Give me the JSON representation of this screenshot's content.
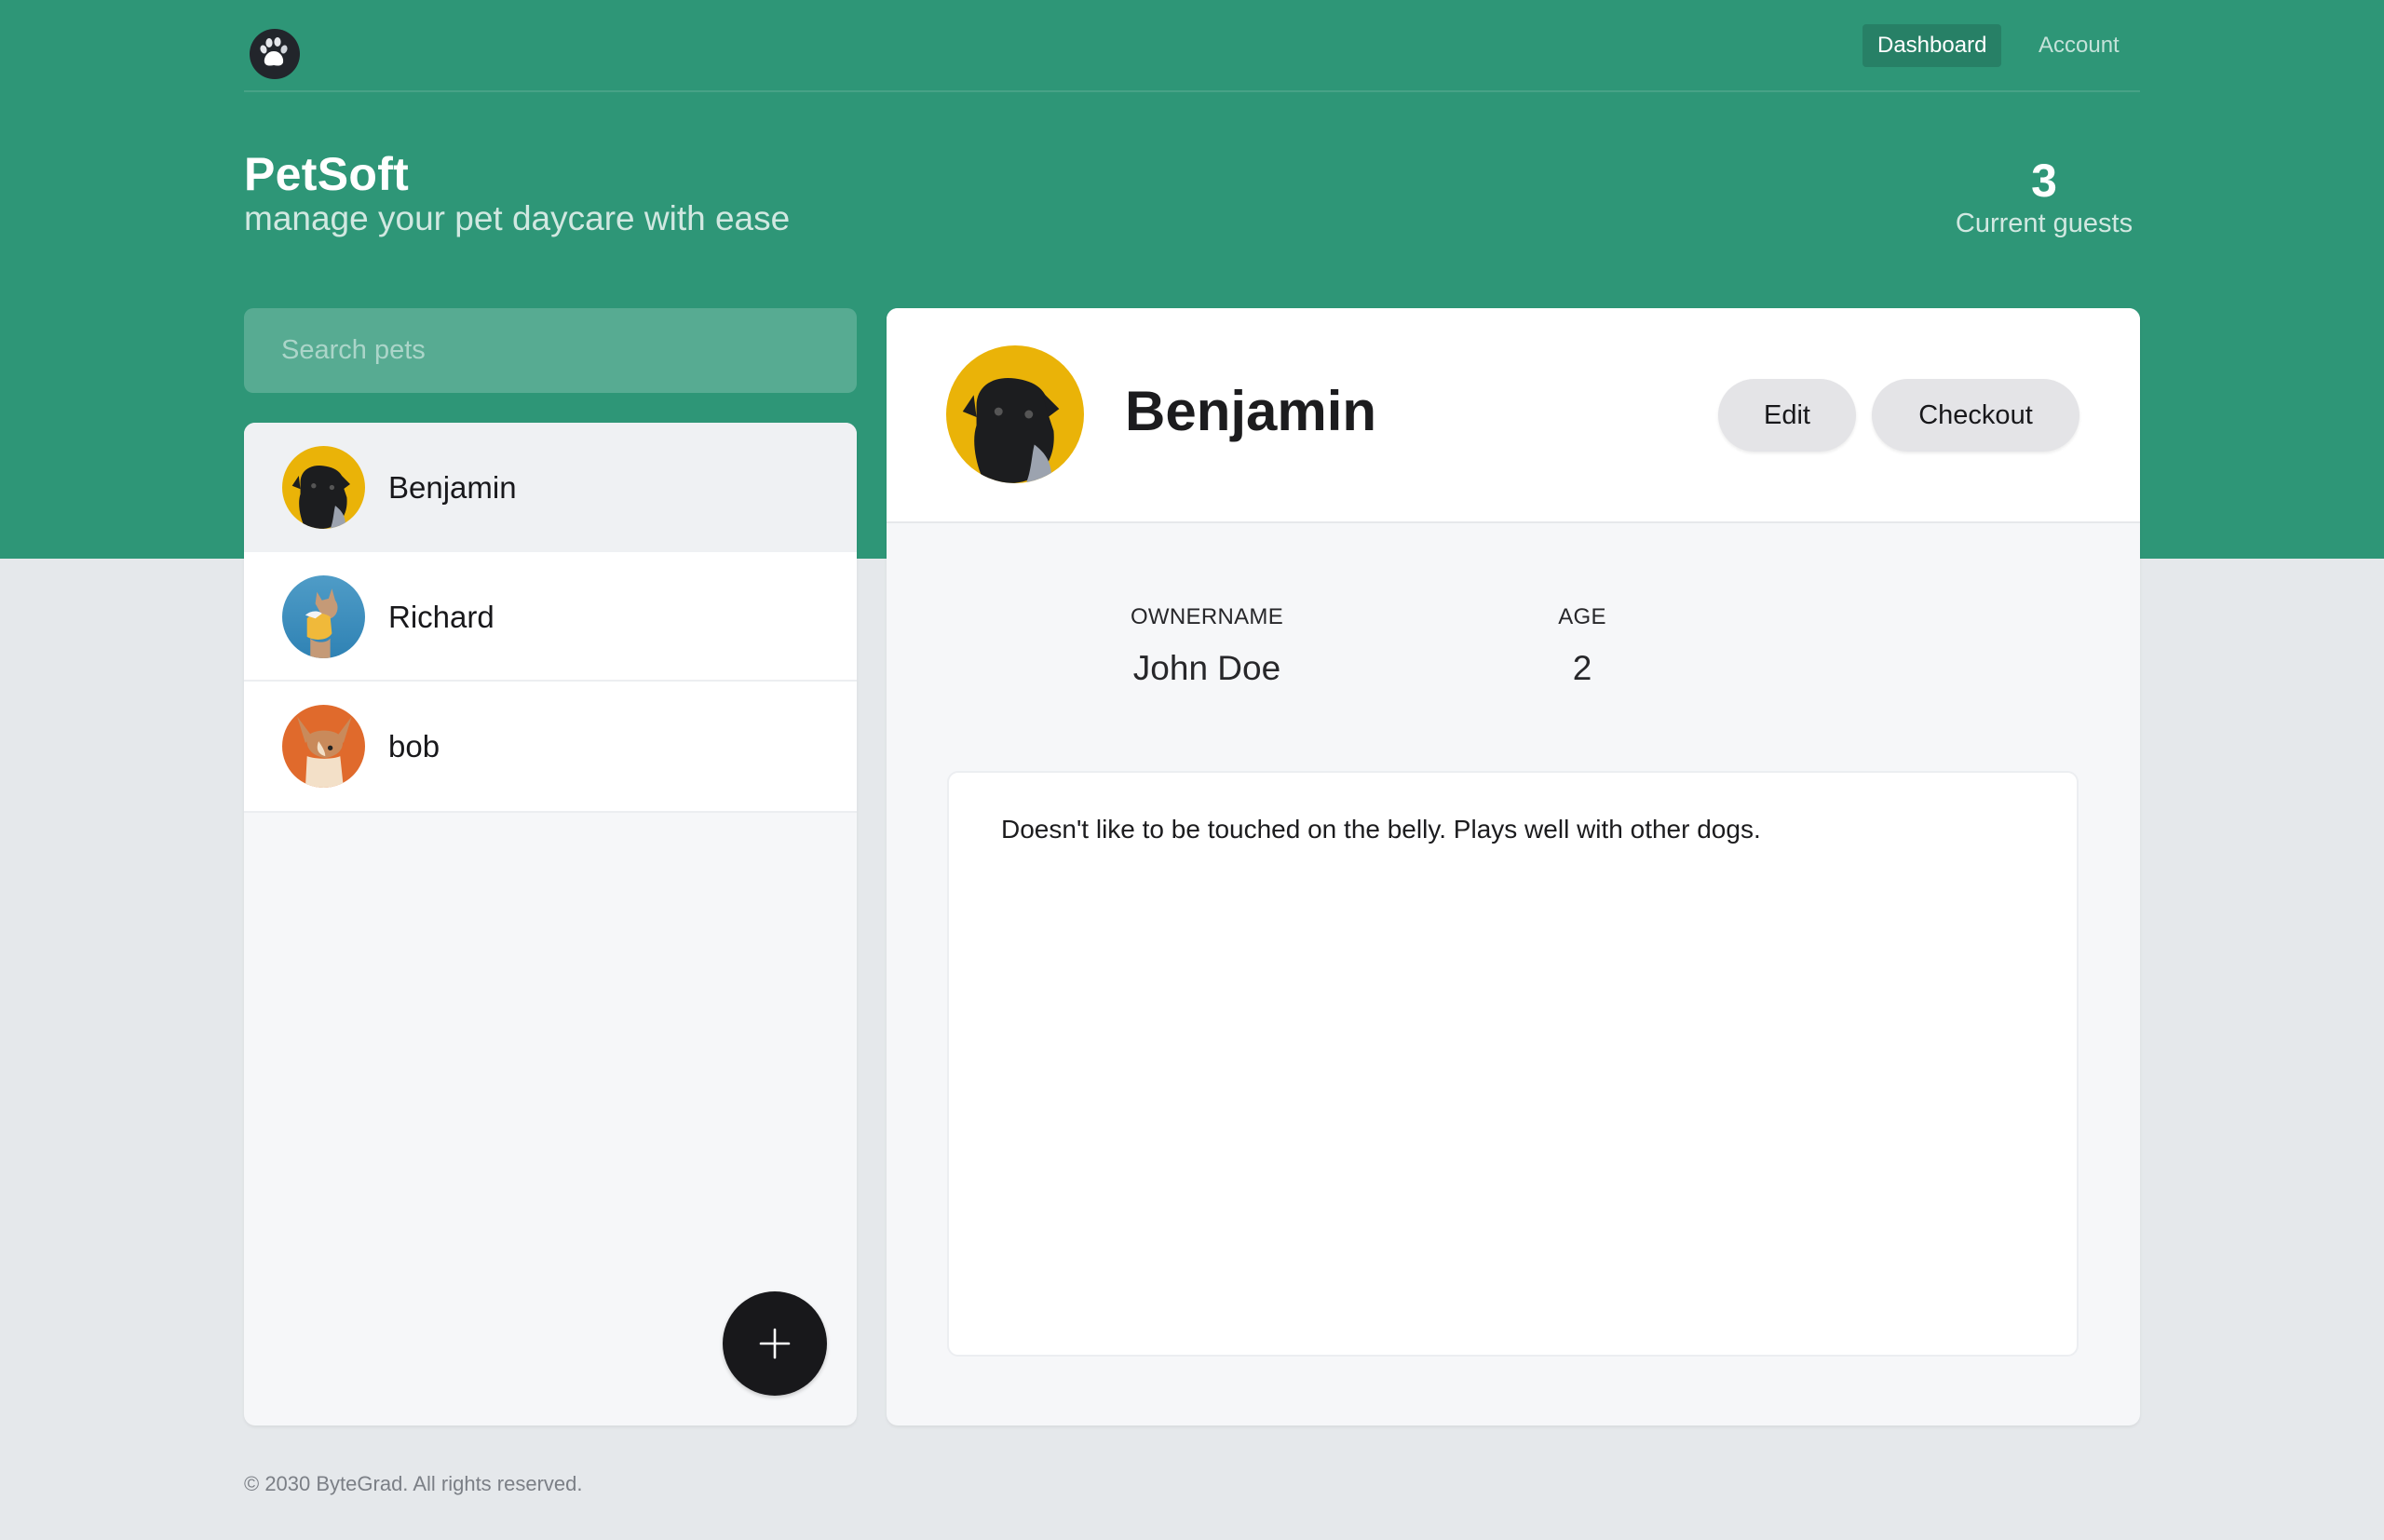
{
  "app": {
    "title": "PetSoft",
    "subtitle": "manage your pet daycare with ease",
    "logo_icon": "paw-icon"
  },
  "nav": {
    "items": [
      {
        "label": "Dashboard",
        "active": true
      },
      {
        "label": "Account",
        "active": false
      }
    ]
  },
  "stats": {
    "current_guests_count": "3",
    "current_guests_label": "Current guests"
  },
  "search": {
    "placeholder": "Search pets",
    "value": ""
  },
  "pets": [
    {
      "name": "Benjamin",
      "selected": true,
      "avatar_bg": "#eab308"
    },
    {
      "name": "Richard",
      "selected": false,
      "avatar_bg": "#3b91c4"
    },
    {
      "name": "bob",
      "selected": false,
      "avatar_bg": "#e06a2c"
    }
  ],
  "add_button": {
    "icon": "plus-icon"
  },
  "detail": {
    "name": "Benjamin",
    "edit_label": "Edit",
    "checkout_label": "Checkout",
    "owner_label": "OWNERNAME",
    "owner_value": "John Doe",
    "age_label": "AGE",
    "age_value": "2",
    "notes": "Doesn't like to be touched on the belly. Plays well with other dogs."
  },
  "footer": {
    "text": "© 2030 ByteGrad. All rights reserved."
  },
  "colors": {
    "brand": "#2e9677",
    "background": "#e5e8eb",
    "dark_button": "#18181b",
    "pill_button": "#e4e4e7"
  }
}
